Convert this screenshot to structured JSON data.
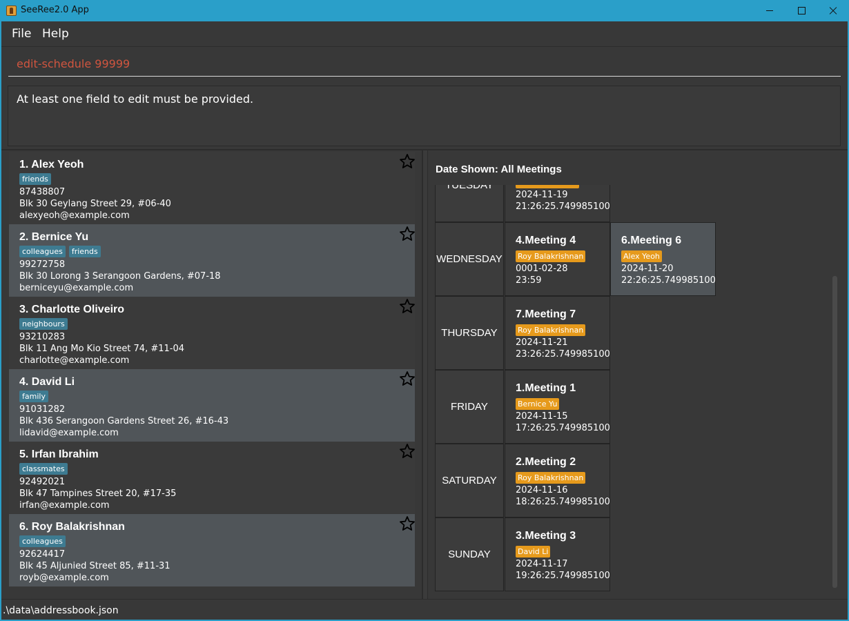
{
  "window": {
    "title": "SeeRee2.0 App"
  },
  "menu": {
    "file": "File",
    "help": "Help"
  },
  "command": {
    "value": "edit-schedule 99999"
  },
  "result": {
    "text": "At least one field to edit must be provided."
  },
  "persons": [
    {
      "name": "1. Alex Yeoh",
      "tags": [
        "friends"
      ],
      "phone": "87438807",
      "address": "Blk 30 Geylang Street 29, #06-40",
      "email": "alexyeoh@example.com"
    },
    {
      "name": "2. Bernice Yu",
      "tags": [
        "colleagues",
        "friends"
      ],
      "phone": "99272758",
      "address": "Blk 30 Lorong 3 Serangoon Gardens, #07-18",
      "email": "berniceyu@example.com"
    },
    {
      "name": "3. Charlotte Oliveiro",
      "tags": [
        "neighbours"
      ],
      "phone": "93210283",
      "address": "Blk 11 Ang Mo Kio Street 74, #11-04",
      "email": "charlotte@example.com"
    },
    {
      "name": "4. David Li",
      "tags": [
        "family"
      ],
      "phone": "91031282",
      "address": "Blk 436 Serangoon Gardens Street 26, #16-43",
      "email": "lidavid@example.com"
    },
    {
      "name": "5. Irfan Ibrahim",
      "tags": [
        "classmates"
      ],
      "phone": "92492021",
      "address": "Blk 47 Tampines Street 20, #17-35",
      "email": "irfan@example.com"
    },
    {
      "name": "6. Roy Balakrishnan",
      "tags": [
        "colleagues"
      ],
      "phone": "92624417",
      "address": "Blk 45 Aljunied Street 85, #11-31",
      "email": "royb@example.com"
    }
  ],
  "schedule": {
    "title": "Date Shown: All Meetings",
    "days": [
      "TUESDAY",
      "WEDNESDAY",
      "THURSDAY",
      "FRIDAY",
      "SATURDAY",
      "SUNDAY"
    ],
    "tuesday_partial": {
      "date": "2024-11-19",
      "time": "21:26:25.749985100"
    },
    "meetings": [
      {
        "title": "4.Meeting 4",
        "contact": "Roy Balakrishnan",
        "date": "0001-02-28",
        "time": "23:59"
      },
      {
        "title": "6.Meeting 6",
        "contact": "Alex Yeoh",
        "date": "2024-11-20",
        "time": "22:26:25.749985100"
      },
      {
        "title": "7.Meeting 7",
        "contact": "Roy Balakrishnan",
        "date": "2024-11-21",
        "time": "23:26:25.749985100"
      },
      {
        "title": "1.Meeting 1",
        "contact": "Bernice Yu",
        "date": "2024-11-15",
        "time": "17:26:25.749985100"
      },
      {
        "title": "2.Meeting 2",
        "contact": "Roy Balakrishnan",
        "date": "2024-11-16",
        "time": "18:26:25.749985100"
      },
      {
        "title": "3.Meeting 3",
        "contact": "David Li",
        "date": "2024-11-17",
        "time": "19:26:25.749985100"
      }
    ]
  },
  "status": {
    "path": ".\\data\\addressbook.json"
  },
  "colors": {
    "titlebar": "#2a9fc9",
    "tag": "#3e7b91",
    "meeting_tag": "#e69a1c",
    "command_text": "#d0553f"
  }
}
